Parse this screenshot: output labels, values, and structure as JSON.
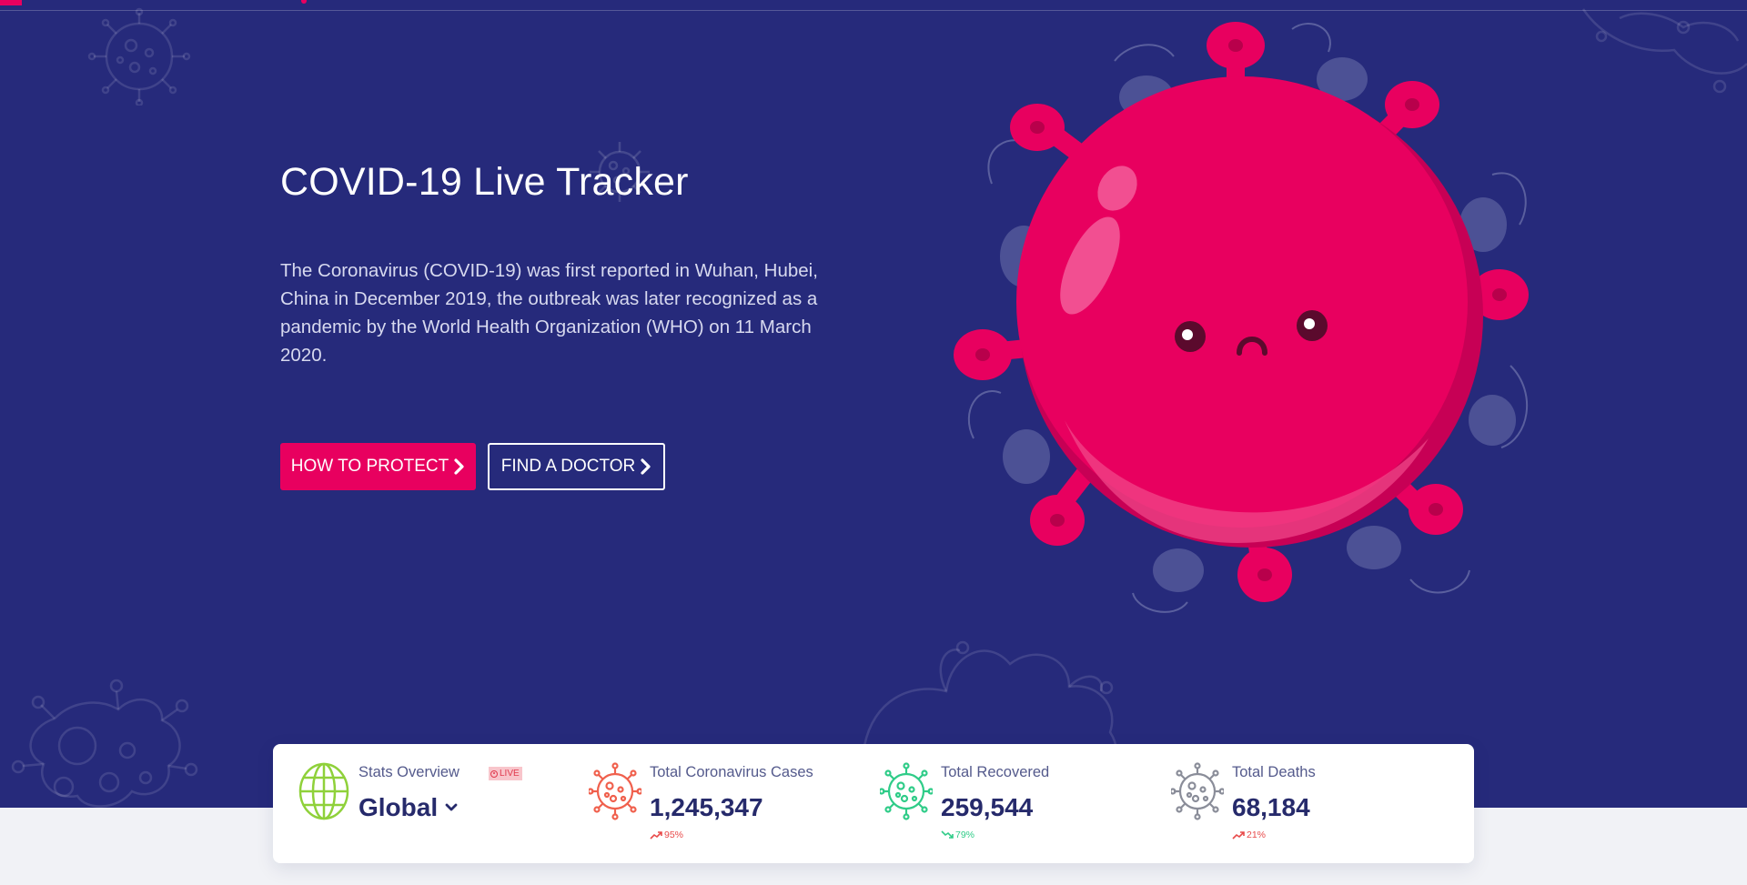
{
  "hero": {
    "title": "COVID-19 Live Tracker",
    "description": "The Coronavirus (COVID-19) was first reported in Wuhan, Hubei, China in December 2019, the outbreak was later recognized as a pandemic by the World Health Organization (WHO) on 11 March 2020.",
    "buttons": {
      "protect_label": "HOW TO PROTECT",
      "doctor_label": "FIND A DOCTOR"
    }
  },
  "stats": {
    "overview": {
      "label": "Stats Overview",
      "live_badge": "LIVE",
      "region": "Global",
      "icon": "globe-icon"
    },
    "items": [
      {
        "label": "Total Coronavirus Cases",
        "value": "1,245,347",
        "trend": "95%",
        "direction": "up",
        "color": "#f0604d",
        "icon": "virus-icon"
      },
      {
        "label": "Total Recovered",
        "value": "259,544",
        "trend": "79%",
        "direction": "down",
        "color": "#2fcc88",
        "icon": "virus-icon"
      },
      {
        "label": "Total Deaths",
        "value": "68,184",
        "trend": "21%",
        "direction": "up",
        "color": "#8a8d99",
        "icon": "virus-icon"
      }
    ]
  },
  "colors": {
    "hero_background": "#262a7b",
    "accent": "#e8005f",
    "page_background": "#f1f2f6",
    "text_dark": "#262a6b",
    "trend_up": "#e84a4a",
    "trend_down": "#2fcc88",
    "globe": "#8fd13a"
  }
}
